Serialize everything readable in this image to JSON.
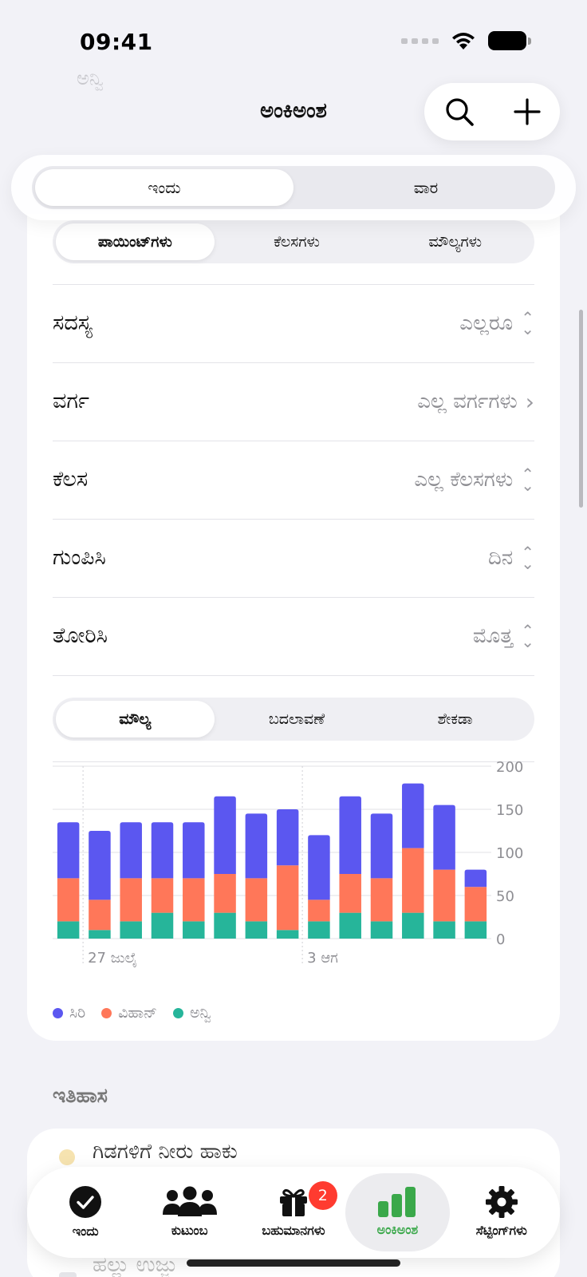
{
  "status": {
    "time": "09:41"
  },
  "nav": {
    "title": "ಅಂಕಿಅಂಶ",
    "search_icon": "search-icon",
    "add_icon": "plus-icon"
  },
  "range": {
    "options": [
      "ಇಂದು",
      "ವಾರ"
    ],
    "selected": "ಇಂದು"
  },
  "metric_tabs": {
    "options": [
      "ಪಾಯಿಂಟ್‌ಗಳು",
      "ಕೆಲಸಗಳು",
      "ಮೌಲ್ಯಗಳು"
    ],
    "selected": "ಪಾಯಿಂಟ್‌ಗಳು"
  },
  "filters": [
    {
      "label": "ಸದಸ್ಯ",
      "value": "ಎಲ್ಲರೂ",
      "control": "updown"
    },
    {
      "label": "ವರ್ಗ",
      "value": "ಎಲ್ಲ ವರ್ಗಗಳು",
      "control": "chevron-right"
    },
    {
      "label": "ಕೆಲಸ",
      "value": "ಎಲ್ಲ ಕೆಲಸಗಳು",
      "control": "updown"
    },
    {
      "label": "ಗುಂಪಿಸಿ",
      "value": "ದಿನ",
      "control": "updown"
    },
    {
      "label": "ತೋರಿಸಿ",
      "value": "ಮೊತ್ತ",
      "control": "updown"
    }
  ],
  "value_tabs": {
    "options": [
      "ಮೌಲ್ಯ",
      "ಬದಲಾವಣೆ",
      "ಶೇಕಡಾ"
    ],
    "selected": "ಮೌಲ್ಯ"
  },
  "chart_data": {
    "type": "bar",
    "stacked": true,
    "categories": [
      "26 ಜುಲೈ",
      "27 ಜುಲೈ",
      "28 ಜುಲೈ",
      "29 ಜುಲೈ",
      "30 ಜುಲೈ",
      "31 ಜುಲೈ",
      "1 ಆಗ",
      "2 ಆಗ",
      "3 ಆಗ",
      "4 ಆಗ",
      "5 ಆಗ",
      "6 ಆಗ",
      "7 ಆಗ",
      "8 ಆಗ"
    ],
    "x_tick_labels": [
      {
        "category_index": 1,
        "label": "27 ಜುಲೈ"
      },
      {
        "category_index": 8,
        "label": "3 ಆಗ"
      }
    ],
    "series": [
      {
        "name": "ಅನ್ವಿ",
        "color": "#26b59a",
        "values": [
          20,
          10,
          20,
          30,
          20,
          30,
          20,
          10,
          20,
          30,
          20,
          30,
          20,
          20
        ]
      },
      {
        "name": "ವಿಹಾನ್",
        "color": "#ff7759",
        "values": [
          50,
          35,
          50,
          40,
          50,
          45,
          50,
          75,
          25,
          45,
          50,
          75,
          60,
          40
        ]
      },
      {
        "name": "ಸಿರಿ",
        "color": "#5b57f0",
        "values": [
          65,
          80,
          65,
          65,
          65,
          90,
          75,
          65,
          75,
          90,
          75,
          75,
          75,
          20
        ]
      }
    ],
    "legend_order": [
      "ಸಿರಿ",
      "ವಿಹಾನ್",
      "ಅನ್ವಿ"
    ],
    "ylim": [
      0,
      200
    ],
    "yticks": [
      0,
      50,
      100,
      150,
      200
    ],
    "y_axis_side": "right",
    "grid": true,
    "legend_position": "bottom-left"
  },
  "history": {
    "title": "ಇತಿಹಾಸ",
    "items": [
      "ಗಿಡಗಳಿಗೆ ನೀರು ಹಾಕು",
      "ಹಲ್ಲು ಉಜ್ಜು"
    ]
  },
  "tabbar": {
    "tabs": [
      {
        "label": "ಇಂದು",
        "icon": "checkmark-circle-icon"
      },
      {
        "label": "ಕುಟುಂಬ",
        "icon": "people-icon"
      },
      {
        "label": "ಬಹುಮಾನಗಳು",
        "icon": "gift-icon",
        "badge": "2"
      },
      {
        "label": "ಅಂಕಿಅಂಶ",
        "icon": "bar-chart-icon"
      },
      {
        "label": "ಸೆಟ್ಟಿಂಗ್‌ಗಳು",
        "icon": "gear-icon"
      }
    ],
    "selected": "ಅಂಕಿಅಂಶ"
  },
  "colors": {
    "accent": "#3aa84a",
    "badge": "#ff3b30"
  }
}
